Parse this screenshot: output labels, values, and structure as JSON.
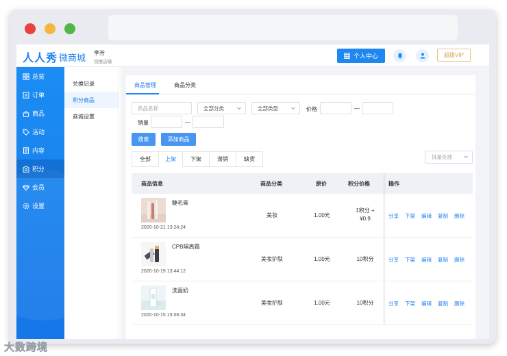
{
  "header": {
    "logo": "人人秀",
    "logo_sub": "微商城",
    "user_name": "李芳",
    "user_switch": "切换店铺",
    "personal_center": "个人中心",
    "vip": "超级VIP"
  },
  "sidebar": {
    "items": [
      {
        "label": "总览",
        "icon": "grid-icon"
      },
      {
        "label": "订单",
        "icon": "order-icon"
      },
      {
        "label": "商品",
        "icon": "bag-icon"
      },
      {
        "label": "活动",
        "icon": "tag-icon"
      },
      {
        "label": "内容",
        "icon": "document-icon"
      },
      {
        "label": "积分",
        "icon": "points-icon"
      },
      {
        "label": "会员",
        "icon": "diamond-icon"
      },
      {
        "label": "设置",
        "icon": "gear-icon"
      }
    ]
  },
  "subnav": {
    "items": [
      "兑换记录",
      "积分商品",
      "商城设置"
    ]
  },
  "top_tabs": [
    "商品管理",
    "商品分类"
  ],
  "filters": {
    "name_placeholder": "商品名称",
    "category": "全部分类",
    "type": "全部类型",
    "price_label": "价格",
    "dash": "—",
    "sales_label": "销量"
  },
  "buttons": {
    "search": "搜索",
    "add": "添加商品",
    "batch": "批量处理"
  },
  "status_tabs": [
    "全部",
    "上架",
    "下架",
    "滞销",
    "缺货"
  ],
  "table": {
    "headers": [
      "商品信息",
      "商品分类",
      "原价",
      "积分价格",
      "操作"
    ],
    "ops": [
      "分享",
      "下架",
      "编辑",
      "复制",
      "删除"
    ],
    "rows": [
      {
        "name": "睫毛膏",
        "date": "2020-10-21 13:24:24",
        "category": "美妆",
        "price": "1.00元",
        "points_line1": "1积分 +",
        "points_line2": "¥0.9"
      },
      {
        "name": "CPB隔离霜",
        "date": "2020-10-19 13:44:12",
        "category": "美妆护肤",
        "price": "1.00元",
        "points_line1": "10积分",
        "points_line2": ""
      },
      {
        "name": "洗面奶",
        "date": "2020-10-15 15:06:34",
        "category": "美妆护肤",
        "price": "1.00元",
        "points_line1": "10积分",
        "points_line2": ""
      }
    ]
  },
  "watermark": "大数跨境",
  "colors": {
    "accent": "#1e88f0",
    "sidebar": "#1677e8",
    "vip": "#d9a24a"
  }
}
